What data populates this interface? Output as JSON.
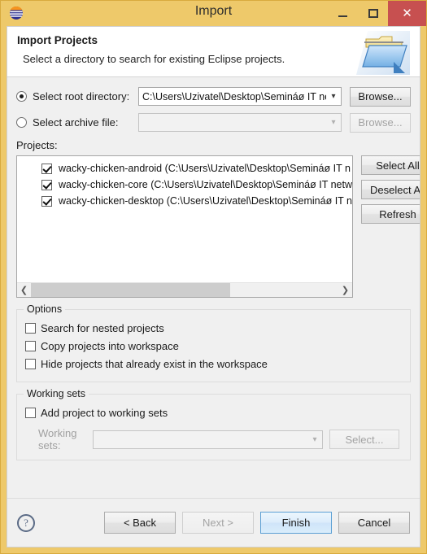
{
  "window": {
    "title": "Import",
    "icon": "eclipse-logo-icon",
    "controls": {
      "minimize": "minimize-icon",
      "maximize": "maximize-icon",
      "close": "close-icon"
    }
  },
  "header": {
    "title": "Import Projects",
    "subtitle": "Select a directory to search for existing Eclipse projects.",
    "icon": "open-folder-icon"
  },
  "source": {
    "root_directory": {
      "radio_label": "Select root directory:",
      "selected": true,
      "value": "C:\\Users\\Uzivatel\\Desktop\\Semináø IT netw",
      "browse_label": "Browse...",
      "browse_enabled": true
    },
    "archive_file": {
      "radio_label": "Select archive file:",
      "selected": false,
      "value": "",
      "browse_label": "Browse...",
      "browse_enabled": false
    }
  },
  "projects": {
    "label": "Projects:",
    "items": [
      {
        "checked": true,
        "text": "wacky-chicken-android (C:\\Users\\Uzivatel\\Desktop\\Semináø IT n"
      },
      {
        "checked": true,
        "text": "wacky-chicken-core (C:\\Users\\Uzivatel\\Desktop\\Semináø IT netw"
      },
      {
        "checked": true,
        "text": "wacky-chicken-desktop (C:\\Users\\Uzivatel\\Desktop\\Semináø IT n"
      }
    ],
    "buttons": {
      "select_all": "Select All",
      "deselect_all": "Deselect All",
      "refresh": "Refresh"
    },
    "scrollbar": {
      "left_arrow": "chevron-left-icon",
      "right_arrow": "chevron-right-icon"
    }
  },
  "options": {
    "title": "Options",
    "items": [
      {
        "checked": false,
        "label": "Search for nested projects"
      },
      {
        "checked": false,
        "label": "Copy projects into workspace"
      },
      {
        "checked": false,
        "label": "Hide projects that already exist in the workspace"
      }
    ]
  },
  "working_sets": {
    "title": "Working sets",
    "add_checkbox": {
      "checked": false,
      "label": "Add project to working sets"
    },
    "combo_label": "Working sets:",
    "combo_value": "",
    "select_label": "Select...",
    "enabled": false
  },
  "footer": {
    "help": "help-icon",
    "buttons": {
      "back": {
        "label": "< Back",
        "enabled": true,
        "default": false
      },
      "next": {
        "label": "Next >",
        "enabled": false,
        "default": false
      },
      "finish": {
        "label": "Finish",
        "enabled": true,
        "default": true
      },
      "cancel": {
        "label": "Cancel",
        "enabled": true,
        "default": false
      }
    }
  },
  "colors": {
    "window_border": "#eec96a",
    "close_button": "#c75050",
    "dialog_background": "#f0f0f0",
    "header_background": "#ffffff",
    "default_button_border": "#5b9fd4"
  }
}
